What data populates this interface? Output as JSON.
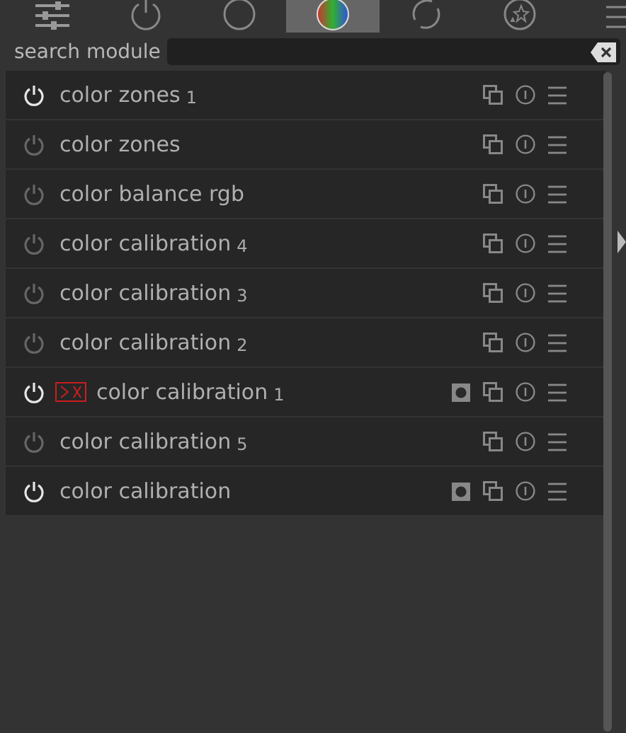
{
  "tabs": [
    {
      "kind": "sliders",
      "selected": false
    },
    {
      "kind": "power",
      "selected": false
    },
    {
      "kind": "circle",
      "selected": false
    },
    {
      "kind": "color",
      "selected": true
    },
    {
      "kind": "cycle",
      "selected": false
    },
    {
      "kind": "stars",
      "selected": false
    }
  ],
  "search": {
    "label": "search module"
  },
  "modules": [
    {
      "name": "color zones",
      "instance": "1",
      "enabled": true,
      "mask": false,
      "warning": false
    },
    {
      "name": "color zones",
      "enabled": false,
      "mask": false,
      "warning": false
    },
    {
      "name": "color balance rgb",
      "enabled": false,
      "mask": false,
      "warning": false
    },
    {
      "name": "color calibration",
      "instance": "4",
      "enabled": false,
      "mask": false,
      "warning": false
    },
    {
      "name": "color calibration",
      "instance": "3",
      "enabled": false,
      "mask": false,
      "warning": false
    },
    {
      "name": "color calibration",
      "instance": "2",
      "enabled": false,
      "mask": false,
      "warning": false
    },
    {
      "name": "color calibration",
      "instance": "1",
      "enabled": true,
      "mask": true,
      "warning": true
    },
    {
      "name": "color calibration",
      "instance": "5",
      "enabled": false,
      "mask": false,
      "warning": false
    },
    {
      "name": "color calibration",
      "enabled": true,
      "mask": true,
      "warning": false
    }
  ]
}
